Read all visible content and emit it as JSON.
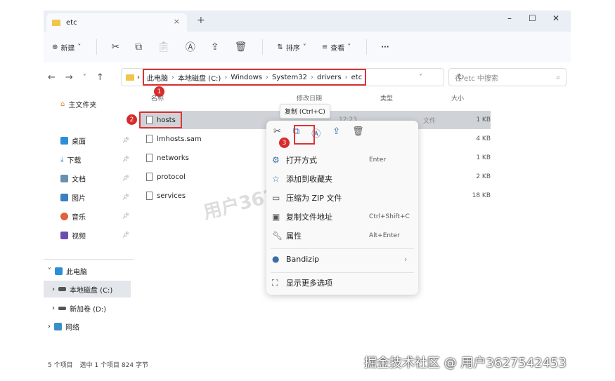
{
  "tab": {
    "title": "etc",
    "close": "×",
    "new": "+"
  },
  "window_controls": {
    "minimize": "–",
    "maximize": "☐",
    "close": "✕"
  },
  "toolbar": {
    "new_label": "新建",
    "sort_label": "排序",
    "view_label": "查看",
    "more": "···"
  },
  "address": {
    "crumbs": [
      "此电脑",
      "本地磁盘 (C:)",
      "Windows",
      "System32",
      "drivers",
      "etc"
    ],
    "search_placeholder": "在 etc 中搜索"
  },
  "columns": {
    "name": "名称",
    "date": "修改日期",
    "type": "类型",
    "size": "大小"
  },
  "sidebar": {
    "home": "主文件夹",
    "items": [
      {
        "label": "桌面",
        "color": "#2a8fd6"
      },
      {
        "label": "下载",
        "color": "#2a8fd6"
      },
      {
        "label": "文档",
        "color": "#6b8fb0"
      },
      {
        "label": "图片",
        "color": "#3a7fc4"
      },
      {
        "label": "音乐",
        "color": "#e0623a"
      },
      {
        "label": "视频",
        "color": "#6b4fb0"
      }
    ],
    "this_pc": "此电脑",
    "drives": [
      "本地磁盘 (C:)",
      "新加卷 (D:)"
    ],
    "network": "网络"
  },
  "files": [
    {
      "name": "hosts",
      "date": "12:23",
      "type": "文件",
      "size": "1 KB"
    },
    {
      "name": "lmhosts.sam",
      "size": "4 KB"
    },
    {
      "name": "networks",
      "size": "1 KB"
    },
    {
      "name": "protocol",
      "size": "2 KB"
    },
    {
      "name": "services",
      "size": "18 KB"
    }
  ],
  "tooltip": "复制 (Ctrl+C)",
  "menu": {
    "items": [
      {
        "label": "打开方式",
        "shortcut": "Enter"
      },
      {
        "label": "添加到收藏夹",
        "shortcut": ""
      },
      {
        "label": "压缩为 ZIP 文件",
        "shortcut": ""
      },
      {
        "label": "复制文件地址",
        "shortcut": "Ctrl+Shift+C"
      },
      {
        "label": "属性",
        "shortcut": "Alt+Enter"
      }
    ],
    "bandizip": "Bandizip",
    "more": "显示更多选项"
  },
  "badges": [
    "1",
    "2",
    "3"
  ],
  "status": {
    "count": "5 个项目",
    "selected": "选中 1 个项目  824 字节"
  },
  "watermark": "用户3627542453",
  "footer_watermark": "掘金技术社区 @ 用户3627542453"
}
